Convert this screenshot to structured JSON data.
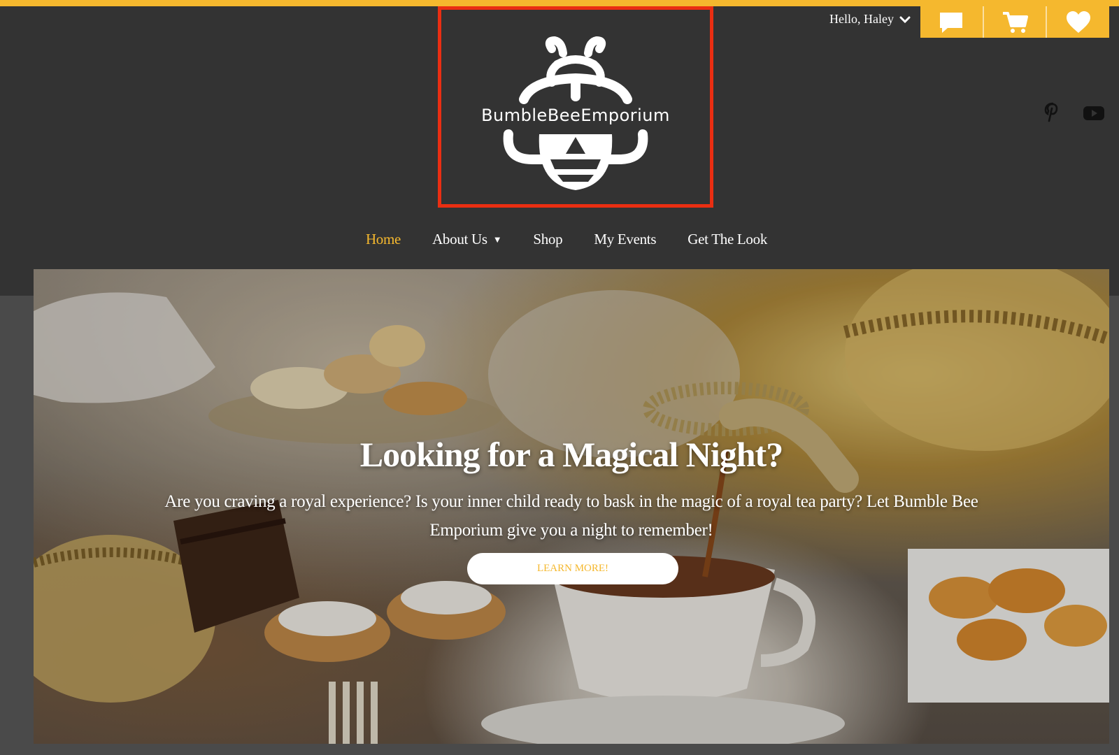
{
  "colors": {
    "accent": "#f5b82e",
    "header_bg": "#333333",
    "page_bg": "#4a4a4a",
    "highlight_border": "#ea2e12"
  },
  "header": {
    "logo_text": "BumbleBeeEmporium",
    "greeting": "Hello, Haley",
    "actions": [
      {
        "icon": "chat-icon"
      },
      {
        "icon": "cart-icon"
      },
      {
        "icon": "heart-icon"
      }
    ],
    "social": [
      {
        "icon": "pinterest-icon"
      },
      {
        "icon": "youtube-icon"
      }
    ]
  },
  "nav": {
    "items": [
      {
        "label": "Home",
        "active": true
      },
      {
        "label": "About Us",
        "dropdown": true
      },
      {
        "label": "Shop"
      },
      {
        "label": "My Events"
      },
      {
        "label": "Get The Look"
      }
    ]
  },
  "hero": {
    "title": "Looking for a Magical Night?",
    "text": "Are you craving a royal experience? Is your inner child ready to bask in the magic of a royal tea party? Let Bumble Bee Emporium give you a night to remember!",
    "button_label": "LEARN MORE!"
  }
}
